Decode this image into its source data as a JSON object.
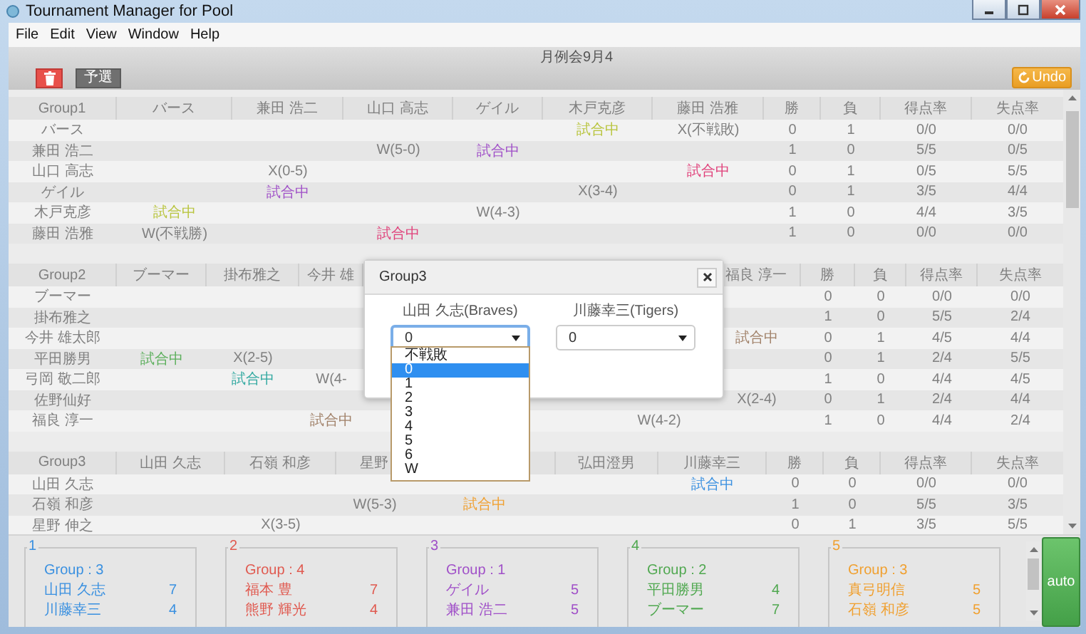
{
  "window": {
    "title": "Tournament Manager for Pool"
  },
  "menu": [
    "File",
    "Edit",
    "View",
    "Window",
    "Help"
  ],
  "toolbar": {
    "title": "月例会9月4",
    "stage_button": "予選",
    "undo_button": "Undo"
  },
  "groups": [
    {
      "label": "Group1",
      "players": [
        {
          "kind": "name",
          "text": "バース"
        },
        {
          "kind": "name",
          "text": "兼田 浩二"
        },
        {
          "kind": "name",
          "text": "山口 高志"
        },
        {
          "kind": "name",
          "text": "ゲイル"
        },
        {
          "kind": "name",
          "text": "木戸克彦"
        },
        {
          "kind": "name",
          "text": "藤田 浩雅"
        }
      ],
      "stats": [
        "勝",
        "負",
        "得点率",
        "失点率"
      ],
      "rows": [
        {
          "name": "バース",
          "results": [
            {
              "kind": "blank"
            },
            {
              "kind": "blank"
            },
            {
              "kind": "blank"
            },
            {
              "kind": "blank"
            },
            {
              "kind": "playing",
              "text": "試合中",
              "color": "#b8c43c"
            },
            {
              "kind": "score",
              "text": "X(不戦敗)"
            }
          ],
          "stats": [
            "0",
            "1",
            "0/0",
            "0/0"
          ]
        },
        {
          "name": "兼田 浩二",
          "results": [
            {
              "kind": "blank"
            },
            {
              "kind": "blank"
            },
            {
              "kind": "score",
              "text": "W(5-0)"
            },
            {
              "kind": "playing",
              "text": "試合中",
              "color": "#a050c8"
            },
            {
              "kind": "blank"
            },
            {
              "kind": "blank"
            }
          ],
          "stats": [
            "1",
            "0",
            "5/5",
            "0/5"
          ]
        },
        {
          "name": "山口 高志",
          "results": [
            {
              "kind": "blank"
            },
            {
              "kind": "score",
              "text": "X(0-5)"
            },
            {
              "kind": "blank"
            },
            {
              "kind": "blank"
            },
            {
              "kind": "blank"
            },
            {
              "kind": "playing",
              "text": "試合中",
              "color": "#e0407a"
            }
          ],
          "stats": [
            "0",
            "1",
            "0/5",
            "5/5"
          ]
        },
        {
          "name": "ゲイル",
          "results": [
            {
              "kind": "blank"
            },
            {
              "kind": "playing",
              "text": "試合中",
              "color": "#a050c8"
            },
            {
              "kind": "blank"
            },
            {
              "kind": "blank"
            },
            {
              "kind": "score",
              "text": "X(3-4)"
            },
            {
              "kind": "blank"
            }
          ],
          "stats": [
            "0",
            "1",
            "3/5",
            "4/4"
          ]
        },
        {
          "name": "木戸克彦",
          "results": [
            {
              "kind": "playing",
              "text": "試合中",
              "color": "#b8c43c"
            },
            {
              "kind": "blank"
            },
            {
              "kind": "blank"
            },
            {
              "kind": "score",
              "text": "W(4-3)"
            },
            {
              "kind": "blank"
            },
            {
              "kind": "blank"
            }
          ],
          "stats": [
            "1",
            "0",
            "4/4",
            "3/5"
          ]
        },
        {
          "name": "藤田 浩雅",
          "results": [
            {
              "kind": "score",
              "text": "W(不戦勝)"
            },
            {
              "kind": "blank"
            },
            {
              "kind": "playing",
              "text": "試合中",
              "color": "#e0407a"
            },
            {
              "kind": "blank"
            },
            {
              "kind": "blank"
            },
            {
              "kind": "blank"
            }
          ],
          "stats": [
            "1",
            "0",
            "0/0",
            "0/0"
          ]
        }
      ]
    },
    {
      "label": "Group2",
      "players": [
        {
          "kind": "name",
          "text": "ブーマー"
        },
        {
          "kind": "name",
          "text": "掛布雅之"
        },
        {
          "kind": "name",
          "text": "今井 雄"
        },
        {
          "kind": "covered"
        },
        {
          "kind": "covered"
        },
        {
          "kind": "covered"
        },
        {
          "kind": "name",
          "text": "福良 淳一"
        }
      ],
      "stats": [
        "勝",
        "負",
        "得点率",
        "失点率"
      ],
      "rows": [
        {
          "name": "ブーマー",
          "results": [
            {
              "kind": "blank"
            },
            {
              "kind": "blank"
            },
            {
              "kind": "blank"
            },
            {
              "kind": "blank"
            },
            {
              "kind": "blank"
            },
            {
              "kind": "blank"
            },
            {
              "kind": "blank"
            }
          ],
          "stats": [
            "0",
            "0",
            "0/0",
            "0/0"
          ]
        },
        {
          "name": "掛布雅之",
          "results": [
            {
              "kind": "blank"
            },
            {
              "kind": "blank"
            },
            {
              "kind": "blank"
            },
            {
              "kind": "blank"
            },
            {
              "kind": "blank"
            },
            {
              "kind": "blank"
            },
            {
              "kind": "blank"
            }
          ],
          "stats": [
            "1",
            "0",
            "5/5",
            "2/4"
          ]
        },
        {
          "name": "今井 雄太郎",
          "results": [
            {
              "kind": "blank"
            },
            {
              "kind": "blank"
            },
            {
              "kind": "blank"
            },
            {
              "kind": "blank"
            },
            {
              "kind": "blank"
            },
            {
              "kind": "blank"
            },
            {
              "kind": "playing",
              "text": "試合中",
              "color": "#a08068"
            }
          ],
          "stats": [
            "0",
            "1",
            "4/5",
            "4/4"
          ]
        },
        {
          "name": "平田勝男",
          "results": [
            {
              "kind": "playing",
              "text": "試合中",
              "color": "#5aae5a"
            },
            {
              "kind": "score",
              "text": "X(2-5)"
            },
            {
              "kind": "blank"
            },
            {
              "kind": "blank"
            },
            {
              "kind": "blank"
            },
            {
              "kind": "blank"
            },
            {
              "kind": "blank"
            }
          ],
          "stats": [
            "0",
            "1",
            "2/4",
            "5/5"
          ]
        },
        {
          "name": "弓岡 敬二郎",
          "results": [
            {
              "kind": "blank"
            },
            {
              "kind": "playing",
              "text": "試合中",
              "color": "#30a8a0"
            },
            {
              "kind": "score",
              "text": "W(4-"
            },
            {
              "kind": "blank"
            },
            {
              "kind": "blank"
            },
            {
              "kind": "blank"
            },
            {
              "kind": "blank"
            }
          ],
          "stats": [
            "1",
            "0",
            "4/4",
            "4/5"
          ]
        },
        {
          "name": "佐野仙好",
          "results": [
            {
              "kind": "blank"
            },
            {
              "kind": "blank"
            },
            {
              "kind": "blank"
            },
            {
              "kind": "blank"
            },
            {
              "kind": "blank"
            },
            {
              "kind": "blank"
            },
            {
              "kind": "score",
              "text": "X(2-4)"
            }
          ],
          "stats": [
            "0",
            "1",
            "2/4",
            "4/4"
          ]
        },
        {
          "name": "福良 淳一",
          "results": [
            {
              "kind": "blank"
            },
            {
              "kind": "blank"
            },
            {
              "kind": "playing",
              "text": "試合中",
              "color": "#a08068"
            },
            {
              "kind": "blank"
            },
            {
              "kind": "blank"
            },
            {
              "kind": "score",
              "text": "W(4-2)"
            },
            {
              "kind": "blank"
            }
          ],
          "stats": [
            "1",
            "0",
            "4/4",
            "2/4"
          ]
        }
      ]
    },
    {
      "label": "Group3",
      "players": [
        {
          "kind": "name",
          "text": "山田 久志"
        },
        {
          "kind": "name",
          "text": "石嶺 和彦"
        },
        {
          "kind": "name",
          "text": "星野"
        },
        {
          "kind": "covered"
        },
        {
          "kind": "name",
          "text": "弘田澄男"
        },
        {
          "kind": "name",
          "text": "川藤幸三"
        }
      ],
      "stats": [
        "勝",
        "負",
        "得点率",
        "失点率"
      ],
      "rows": [
        {
          "name": "山田 久志",
          "results": [
            {
              "kind": "blank"
            },
            {
              "kind": "blank"
            },
            {
              "kind": "blank"
            },
            {
              "kind": "blank"
            },
            {
              "kind": "blank"
            },
            {
              "kind": "playing",
              "text": "試合中",
              "color": "#3a90e0"
            }
          ],
          "stats": [
            "0",
            "0",
            "0/0",
            "0/0"
          ]
        },
        {
          "name": "石嶺 和彦",
          "results": [
            {
              "kind": "blank"
            },
            {
              "kind": "blank"
            },
            {
              "kind": "score",
              "text": "W(5-3)"
            },
            {
              "kind": "playing",
              "text": "試合中",
              "color": "#f0a030"
            },
            {
              "kind": "blank"
            },
            {
              "kind": "blank"
            }
          ],
          "stats": [
            "1",
            "0",
            "5/5",
            "3/5"
          ]
        },
        {
          "name": "星野 伸之",
          "results": [
            {
              "kind": "blank"
            },
            {
              "kind": "score",
              "text": "X(3-5)"
            },
            {
              "kind": "blank"
            },
            {
              "kind": "blank"
            },
            {
              "kind": "blank"
            },
            {
              "kind": "blank"
            }
          ],
          "stats": [
            "0",
            "1",
            "3/5",
            "5/5"
          ]
        }
      ]
    }
  ],
  "tables": [
    {
      "number": "1",
      "color": "#3a90e0",
      "group": "Group : 3",
      "players": [
        {
          "name": "山田 久志",
          "score": "7"
        },
        {
          "name": "川藤幸三",
          "score": "4"
        }
      ]
    },
    {
      "number": "2",
      "color": "#e05a50",
      "group": "Group : 4",
      "players": [
        {
          "name": "福本 豊",
          "score": "7"
        },
        {
          "name": "熊野 輝光",
          "score": "4"
        }
      ]
    },
    {
      "number": "3",
      "color": "#a050c8",
      "group": "Group : 1",
      "players": [
        {
          "name": "ゲイル",
          "score": "5"
        },
        {
          "name": "兼田 浩二",
          "score": "5"
        }
      ]
    },
    {
      "number": "4",
      "color": "#50a850",
      "group": "Group : 2",
      "players": [
        {
          "name": "平田勝男",
          "score": "4"
        },
        {
          "name": "ブーマー",
          "score": "7"
        }
      ]
    },
    {
      "number": "5",
      "color": "#f0a030",
      "group": "Group : 3",
      "players": [
        {
          "name": "真弓明信",
          "score": "5"
        },
        {
          "name": "石嶺 和彦",
          "score": "5"
        }
      ]
    }
  ],
  "auto_button": "auto",
  "dialog": {
    "title": "Group3",
    "sides": [
      {
        "player": "山田 久志(Braves)",
        "value": "0",
        "open": true
      },
      {
        "player": "川藤幸三(Tigers)",
        "value": "0",
        "open": false
      }
    ],
    "options": [
      {
        "label": "不戦敗",
        "selected": false
      },
      {
        "label": "0",
        "selected": true
      },
      {
        "label": "1",
        "selected": false
      },
      {
        "label": "2",
        "selected": false
      },
      {
        "label": "3",
        "selected": false
      },
      {
        "label": "4",
        "selected": false
      },
      {
        "label": "5",
        "selected": false
      },
      {
        "label": "6",
        "selected": false
      },
      {
        "label": "W",
        "selected": false
      }
    ]
  }
}
